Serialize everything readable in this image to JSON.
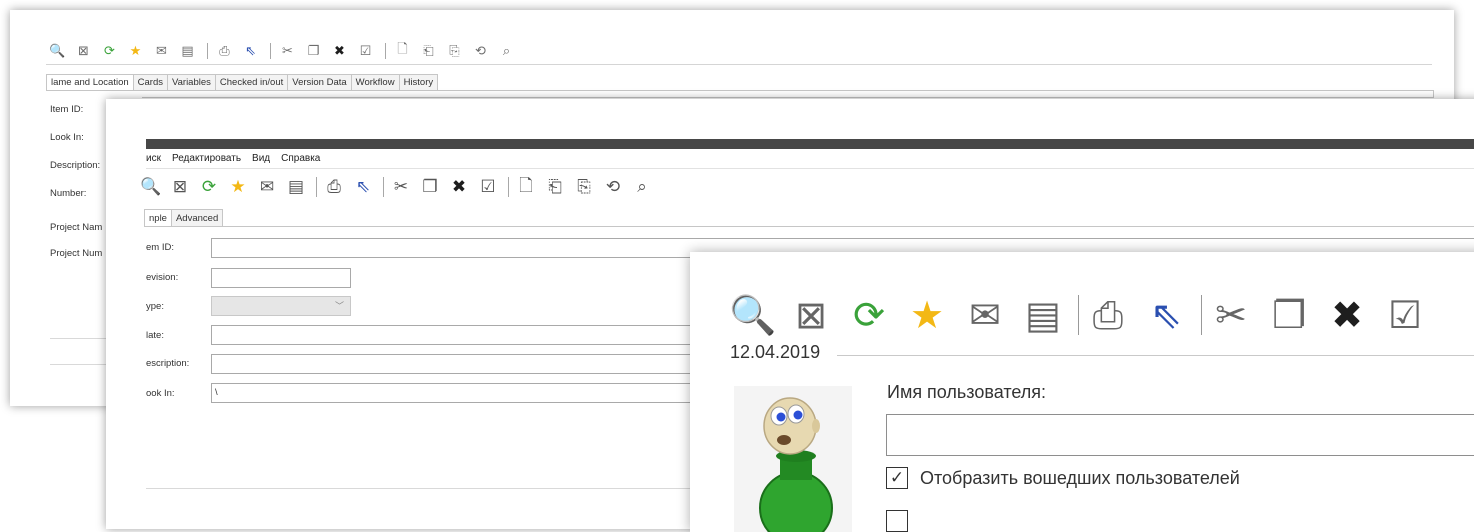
{
  "back_window": {
    "toolbar_icons": [
      {
        "name": "search-icon",
        "glyph": "🔍"
      },
      {
        "name": "close-document-icon",
        "glyph": "⊠"
      },
      {
        "name": "refresh-icon",
        "glyph": "⟳"
      },
      {
        "name": "star-icon",
        "glyph": "★"
      },
      {
        "name": "mail-icon",
        "glyph": "✉"
      },
      {
        "name": "save-icon",
        "glyph": "▤"
      },
      {
        "name": "print-icon",
        "glyph": "⎙"
      },
      {
        "name": "help-cursor-icon",
        "glyph": "⇖"
      },
      {
        "name": "cut-icon",
        "glyph": "✂"
      },
      {
        "name": "copy-icon",
        "glyph": "❐"
      },
      {
        "name": "delete-icon",
        "glyph": "✖"
      },
      {
        "name": "checkout-icon",
        "glyph": "☑"
      },
      {
        "name": "document-icon",
        "glyph": "🗋"
      },
      {
        "name": "document-in-icon",
        "glyph": "⎗"
      },
      {
        "name": "document-out-icon",
        "glyph": "⎘"
      },
      {
        "name": "history-icon",
        "glyph": "⟲"
      },
      {
        "name": "preview-icon",
        "glyph": "⌕"
      }
    ],
    "tabs": [
      "lame and Location",
      "Cards",
      "Variables",
      "Checked in/out",
      "Version Data",
      "Workflow",
      "History"
    ],
    "labels": [
      "Item ID:",
      "Look In:",
      "Description:",
      "Number:",
      "Project Nam",
      "Project Num"
    ]
  },
  "middle_window": {
    "menu": [
      "иск",
      "Редактировать",
      "Вид",
      "Справка"
    ],
    "toolbar_icons": [
      {
        "name": "search-icon",
        "glyph": "🔍"
      },
      {
        "name": "close-document-icon",
        "glyph": "⊠"
      },
      {
        "name": "refresh-icon",
        "glyph": "⟳"
      },
      {
        "name": "star-icon",
        "glyph": "★"
      },
      {
        "name": "mail-icon",
        "glyph": "✉"
      },
      {
        "name": "save-icon",
        "glyph": "▤"
      },
      {
        "name": "print-icon",
        "glyph": "⎙"
      },
      {
        "name": "help-cursor-icon",
        "glyph": "⇖"
      },
      {
        "name": "cut-icon",
        "glyph": "✂"
      },
      {
        "name": "copy-icon",
        "glyph": "❐"
      },
      {
        "name": "delete-icon",
        "glyph": "✖"
      },
      {
        "name": "checkout-icon",
        "glyph": "☑"
      },
      {
        "name": "document-icon",
        "glyph": "🗋"
      },
      {
        "name": "document-in-icon",
        "glyph": "⎗"
      },
      {
        "name": "document-out-icon",
        "glyph": "⎘"
      },
      {
        "name": "history-icon",
        "glyph": "⟲"
      },
      {
        "name": "preview-icon",
        "glyph": "⌕"
      }
    ],
    "tabs": [
      "nple",
      "Advanced"
    ],
    "fields": {
      "item_id_label": "em ID:",
      "revision_label": "evision:",
      "type_label": "ype:",
      "date_label": "late:",
      "description_label": "escription:",
      "look_in_label": "ook In:",
      "look_in_value": "\\"
    }
  },
  "front_window": {
    "toolbar_icons": [
      {
        "name": "search-icon",
        "glyph": "🔍"
      },
      {
        "name": "close-document-icon",
        "glyph": "⊠"
      },
      {
        "name": "refresh-icon",
        "glyph": "⟳"
      },
      {
        "name": "star-icon",
        "glyph": "★"
      },
      {
        "name": "mail-icon",
        "glyph": "✉"
      },
      {
        "name": "save-icon",
        "glyph": "▤"
      },
      {
        "name": "print-icon",
        "glyph": "⎙"
      },
      {
        "name": "help-cursor-icon",
        "glyph": "⇖"
      },
      {
        "name": "cut-icon",
        "glyph": "✂"
      },
      {
        "name": "copy-icon",
        "glyph": "❐"
      },
      {
        "name": "delete-icon",
        "glyph": "✖"
      },
      {
        "name": "checkout-icon",
        "glyph": "☑"
      }
    ],
    "date": "12.04.2019",
    "username_label": "Имя пользователя:",
    "username_value": "",
    "show_logged_in_label": "Отобразить вошедших пользователей",
    "show_logged_in_checked": true
  },
  "colors": {
    "star": "#f3b815",
    "refresh": "#3aa23a",
    "delete": "#1e1e1e",
    "help": "#2a4fb0",
    "titlebar": "#474747",
    "avatar_body": "#2fa52f",
    "avatar_head": "#e7d9b1"
  }
}
